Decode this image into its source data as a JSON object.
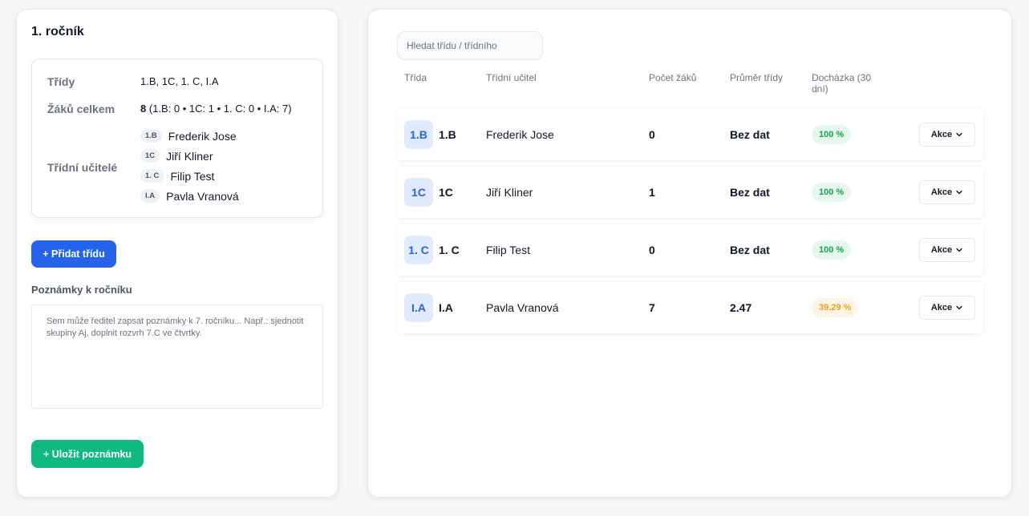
{
  "grade": {
    "title": "1. ročník",
    "summary": {
      "classes_label": "Třídy",
      "classes_value": "1.B, 1C, 1. C, I.A",
      "students_label": "Žáků celkem",
      "students_total": "8",
      "students_breakdown": "(1.B: 0 • 1C: 1 • 1. C: 0 • I.A: 7)",
      "teachers_label": "Třídní učitelé",
      "teachers": [
        {
          "class": "1.B",
          "name": "Frederik Jose"
        },
        {
          "class": "1C",
          "name": "Jiří Kliner"
        },
        {
          "class": "1. C",
          "name": "Filip Test"
        },
        {
          "class": "I.A",
          "name": "Pavla Vranová"
        }
      ]
    },
    "add_class_label": "+ Přidat třídu",
    "notes_label": "Poznámky k ročníku",
    "notes_placeholder": "Sem může ředitel zapsat poznámky k 7. ročníku... Např.: sjednotit skupiny Aj, doplnit rozvrh 7.C ve čtvrtky.",
    "save_note_label": "+ Uložit poznámku"
  },
  "table": {
    "search_placeholder": "Hledat třídu / třídního",
    "headers": {
      "class": "Třída",
      "teacher": "Třídní učitel",
      "count": "Počet žáků",
      "avg": "Průměr třídy",
      "attendance": "Docházka (30 dní)"
    },
    "rows": [
      {
        "avatar": "1.B",
        "class": "1.B",
        "teacher": "Frederik Jose",
        "count": "0",
        "avg": "Bez dat",
        "attendance": "100 %",
        "action": "Akce"
      },
      {
        "avatar": "1C",
        "class": "1C",
        "teacher": "Jiří Kliner",
        "count": "1",
        "avg": "Bez dat",
        "attendance": "100 %",
        "action": "Akce"
      },
      {
        "avatar": "1. C",
        "class": "1. C",
        "teacher": "Filip Test",
        "count": "0",
        "avg": "Bez dat",
        "attendance": "100 %",
        "action": "Akce"
      },
      {
        "avatar": "I.A",
        "class": "I.A",
        "teacher": "Pavla Vranová",
        "count": "7",
        "avg": "2.47",
        "attendance": "39.29 %",
        "action": "Akce"
      }
    ]
  },
  "colors": {
    "primary": "#2563eb",
    "success": "#10b981",
    "good_badge": "#16a34a",
    "warn_badge": "#f59e0b"
  },
  "icons": {
    "action_chevron": "chevron-down-icon"
  }
}
